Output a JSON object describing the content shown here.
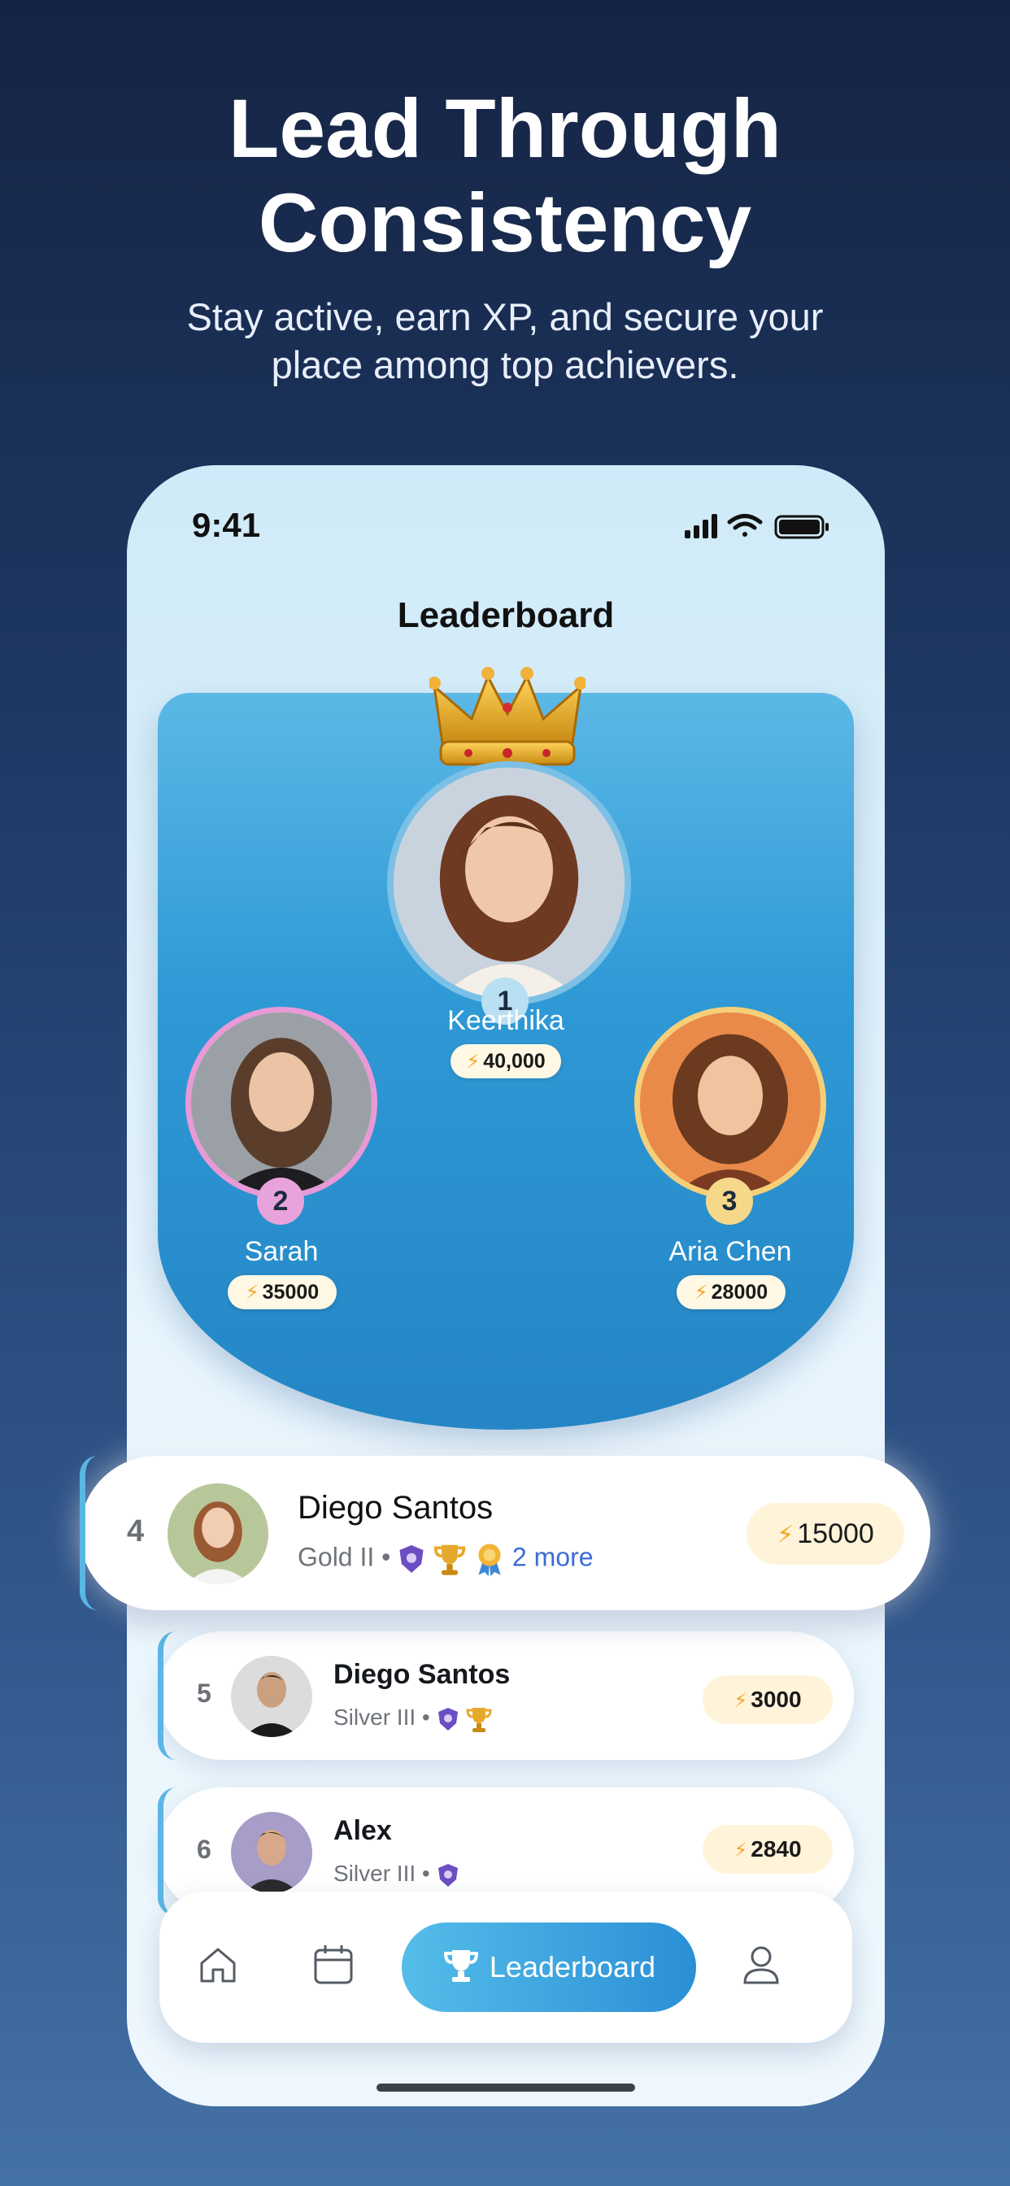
{
  "headline_line1": "Lead Through",
  "headline_line2": "Consistency",
  "subtitle_line1": "Stay active, earn XP, and secure your",
  "subtitle_line2": "place among top achievers.",
  "status": {
    "time": "9:41"
  },
  "screen_title": "Leaderboard",
  "podium": [
    {
      "rank": "1",
      "name": "Keerthika",
      "xp": "40,000",
      "ring_color": "#7cc0e6",
      "badge_color": "#b9dff3"
    },
    {
      "rank": "2",
      "name": "Sarah",
      "xp": "35000",
      "ring_color": "#e79ad6",
      "badge_color": "#e8a2dc"
    },
    {
      "rank": "3",
      "name": "Aria Chen",
      "xp": "28000",
      "ring_color": "#f6cf79",
      "badge_color": "#f6d88a"
    }
  ],
  "rows": [
    {
      "rank": "4",
      "name": "Diego Santos",
      "tier": "Gold II",
      "more": "2 more",
      "xp": "15000"
    },
    {
      "rank": "5",
      "name": "Diego Santos",
      "tier": "Silver III",
      "xp": "3000"
    },
    {
      "rank": "6",
      "name": "Alex",
      "tier": "Silver III",
      "xp": "2840"
    }
  ],
  "nav": {
    "items": [
      "home-icon",
      "calendar-icon",
      "trophy-icon",
      "profile-icon"
    ],
    "active_label": "Leaderboard"
  },
  "colors": {
    "accent": "#2a8fd6",
    "xp_bg": "#fff3da",
    "bolt": "#f5a623"
  }
}
